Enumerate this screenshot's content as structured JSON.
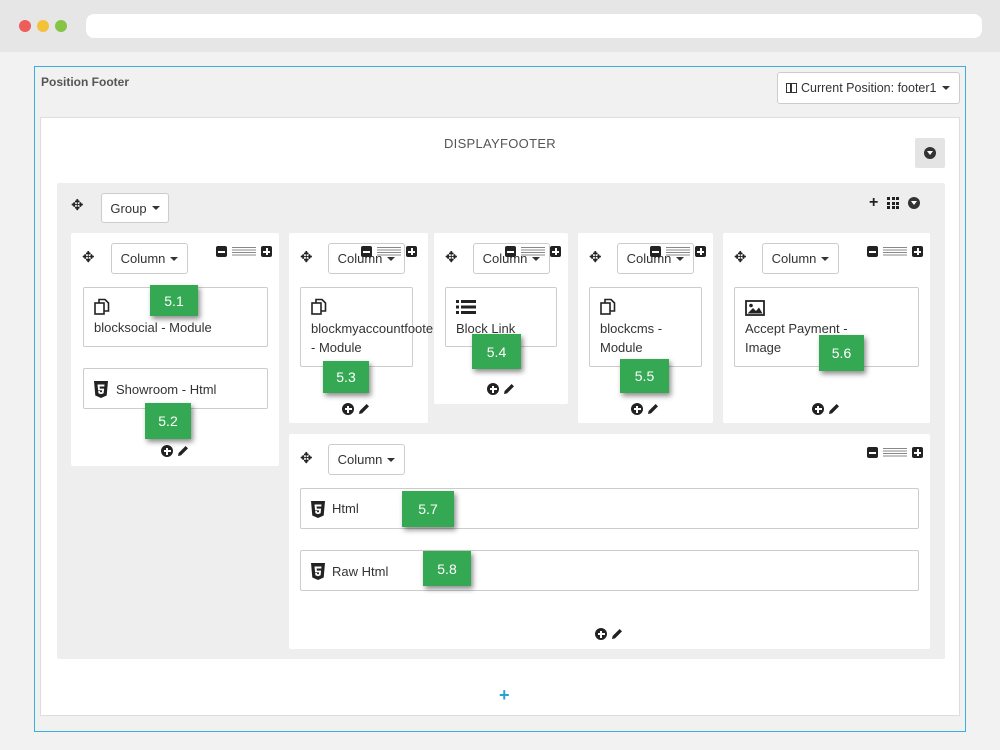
{
  "panel": {
    "title": "Position Footer",
    "position_button": "Current Position: footer1"
  },
  "hook": {
    "title": "DISPLAYFOOTER"
  },
  "group": {
    "button_label": "Group"
  },
  "columns": [
    {
      "button_label": "Column",
      "modules": [
        {
          "label": "blocksocial - Module",
          "icon": "copy-icon"
        },
        {
          "label": "Showroom - Html",
          "icon": "html5-icon"
        }
      ]
    },
    {
      "button_label": "Column",
      "modules": [
        {
          "line1": "blockmyaccountfooter",
          "line2": "- Module",
          "icon": "copy-icon"
        }
      ]
    },
    {
      "button_label": "Column",
      "modules": [
        {
          "label": "Block Link",
          "icon": "list-icon"
        }
      ]
    },
    {
      "button_label": "Column",
      "modules": [
        {
          "line1": "blockcms -",
          "line2": "Module",
          "icon": "copy-icon"
        }
      ]
    },
    {
      "button_label": "Column",
      "modules": [
        {
          "line1": "Accept Payment -",
          "line2": "Image",
          "icon": "image-icon"
        }
      ]
    },
    {
      "button_label": "Column",
      "modules": [
        {
          "label": "Html",
          "icon": "html5-icon"
        },
        {
          "label": "Raw Html",
          "icon": "html5-icon"
        }
      ]
    }
  ],
  "badges": [
    "5.1",
    "5.2",
    "5.3",
    "5.4",
    "5.5",
    "5.6",
    "5.7",
    "5.8"
  ],
  "colors": {
    "badge": "#35a853",
    "panel_border": "#3ab0d8",
    "add_plus": "#2aa1d6"
  }
}
